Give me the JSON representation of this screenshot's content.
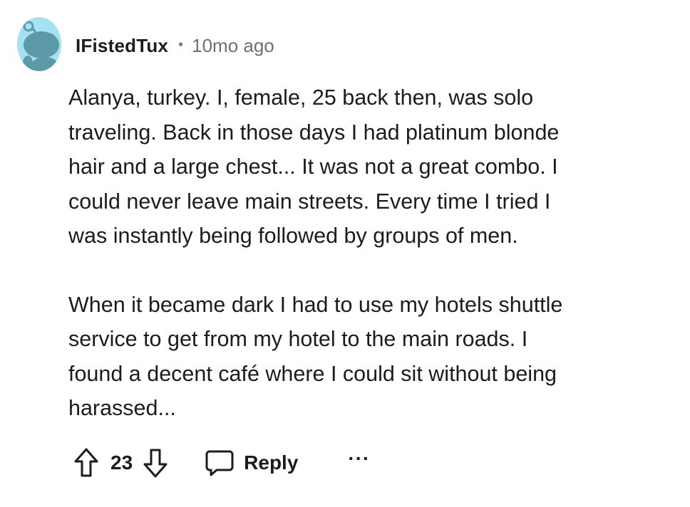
{
  "comment": {
    "author": "IFistedTux",
    "separator": "•",
    "age": "10mo ago",
    "paragraphs": [
      [
        "Alanya, turkey. I, female, 25 back then, was solo",
        "traveling. Back in those days I had platinum blonde",
        "hair and a large chest... It was not a great combo. I",
        "could never leave main streets. Every time I tried I",
        "was instantly being followed by groups of men."
      ],
      [
        "When it became dark I had to use my hotels shuttle",
        "service to get from my hotel to the main roads. I",
        "found a decent café where I could sit without being",
        "harassed..."
      ]
    ]
  },
  "actions": {
    "score": "23",
    "reply_label": "Reply",
    "more_label": "···"
  },
  "icons": {
    "avatar": "snoo-avatar-icon",
    "upvote": "arrow-up-icon",
    "downvote": "arrow-down-icon",
    "reply": "speech-bubble-icon",
    "more": "ellipsis-icon"
  },
  "colors": {
    "avatar_bg": "#a6e0f5",
    "avatar_figure": "#5b9aa6",
    "text": "#1c1c1c",
    "meta": "#6f6f6f"
  }
}
